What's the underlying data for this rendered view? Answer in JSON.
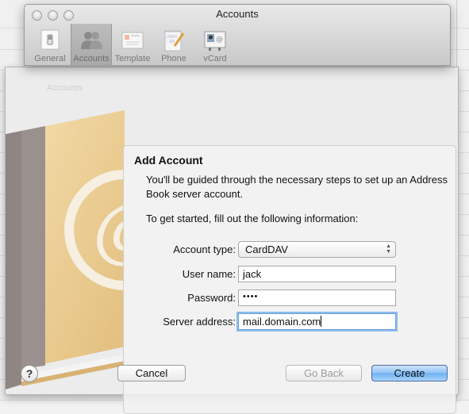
{
  "window": {
    "title": "Accounts",
    "toolbar": [
      {
        "label": "General",
        "icon": "switch-icon",
        "selected": false
      },
      {
        "label": "Accounts",
        "icon": "people-icon",
        "selected": true
      },
      {
        "label": "Template",
        "icon": "card-template-icon",
        "selected": false
      },
      {
        "label": "Phone",
        "icon": "notepad-pencil-icon",
        "selected": false
      },
      {
        "label": "vCard",
        "icon": "vcard-icon",
        "selected": false
      }
    ]
  },
  "background": {
    "ghost_label": "Accounts"
  },
  "sheet": {
    "title": "Add Account",
    "description": "You'll be guided through the necessary steps to set up an Address Book server account.",
    "instruction": "To get started, fill out the following information:",
    "fields": {
      "account_type": {
        "label": "Account type:",
        "value": "CardDAV"
      },
      "user_name": {
        "label": "User name:",
        "value": "jack"
      },
      "password": {
        "label": "Password:",
        "value": "••••"
      },
      "server_address": {
        "label": "Server address:",
        "value": "mail.domain.com"
      }
    },
    "buttons": {
      "help": "?",
      "cancel": "Cancel",
      "go_back": "Go Back",
      "create": "Create"
    }
  },
  "colors": {
    "primary_button": "#8fc2f5",
    "focus_ring": "#8cbbea",
    "book_cover": "#e8c98e",
    "book_spine": "#8f8583"
  }
}
